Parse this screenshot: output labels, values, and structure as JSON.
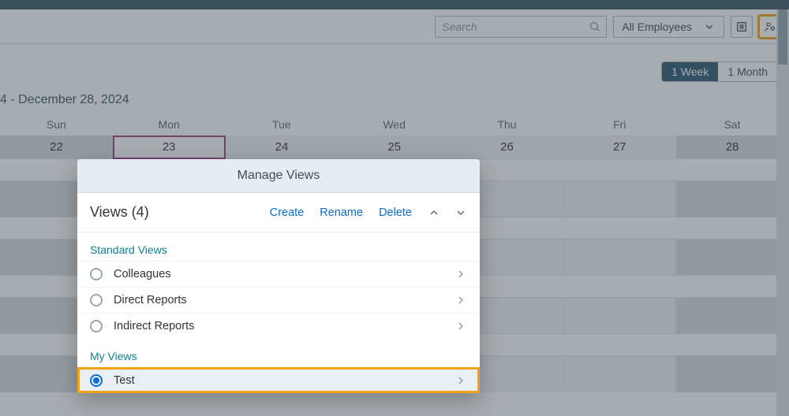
{
  "toolbar": {
    "search_placeholder": "Search",
    "filter_label": "All Employees"
  },
  "range_toggle": {
    "week": "1 Week",
    "month": "1 Month"
  },
  "date_range": "4 - December 28, 2024",
  "days": [
    "Sun",
    "Mon",
    "Tue",
    "Wed",
    "Thu",
    "Fri",
    "Sat"
  ],
  "dates": [
    "22",
    "23",
    "24",
    "25",
    "26",
    "27",
    "28"
  ],
  "dialog": {
    "title": "Manage Views",
    "count_label": "Views (4)",
    "actions": {
      "create": "Create",
      "rename": "Rename",
      "delete": "Delete"
    },
    "sections": {
      "standard": "Standard Views",
      "mine": "My Views"
    },
    "standard_views": [
      {
        "label": "Colleagues"
      },
      {
        "label": "Direct Reports"
      },
      {
        "label": "Indirect Reports"
      }
    ],
    "my_views": [
      {
        "label": "Test"
      }
    ]
  }
}
